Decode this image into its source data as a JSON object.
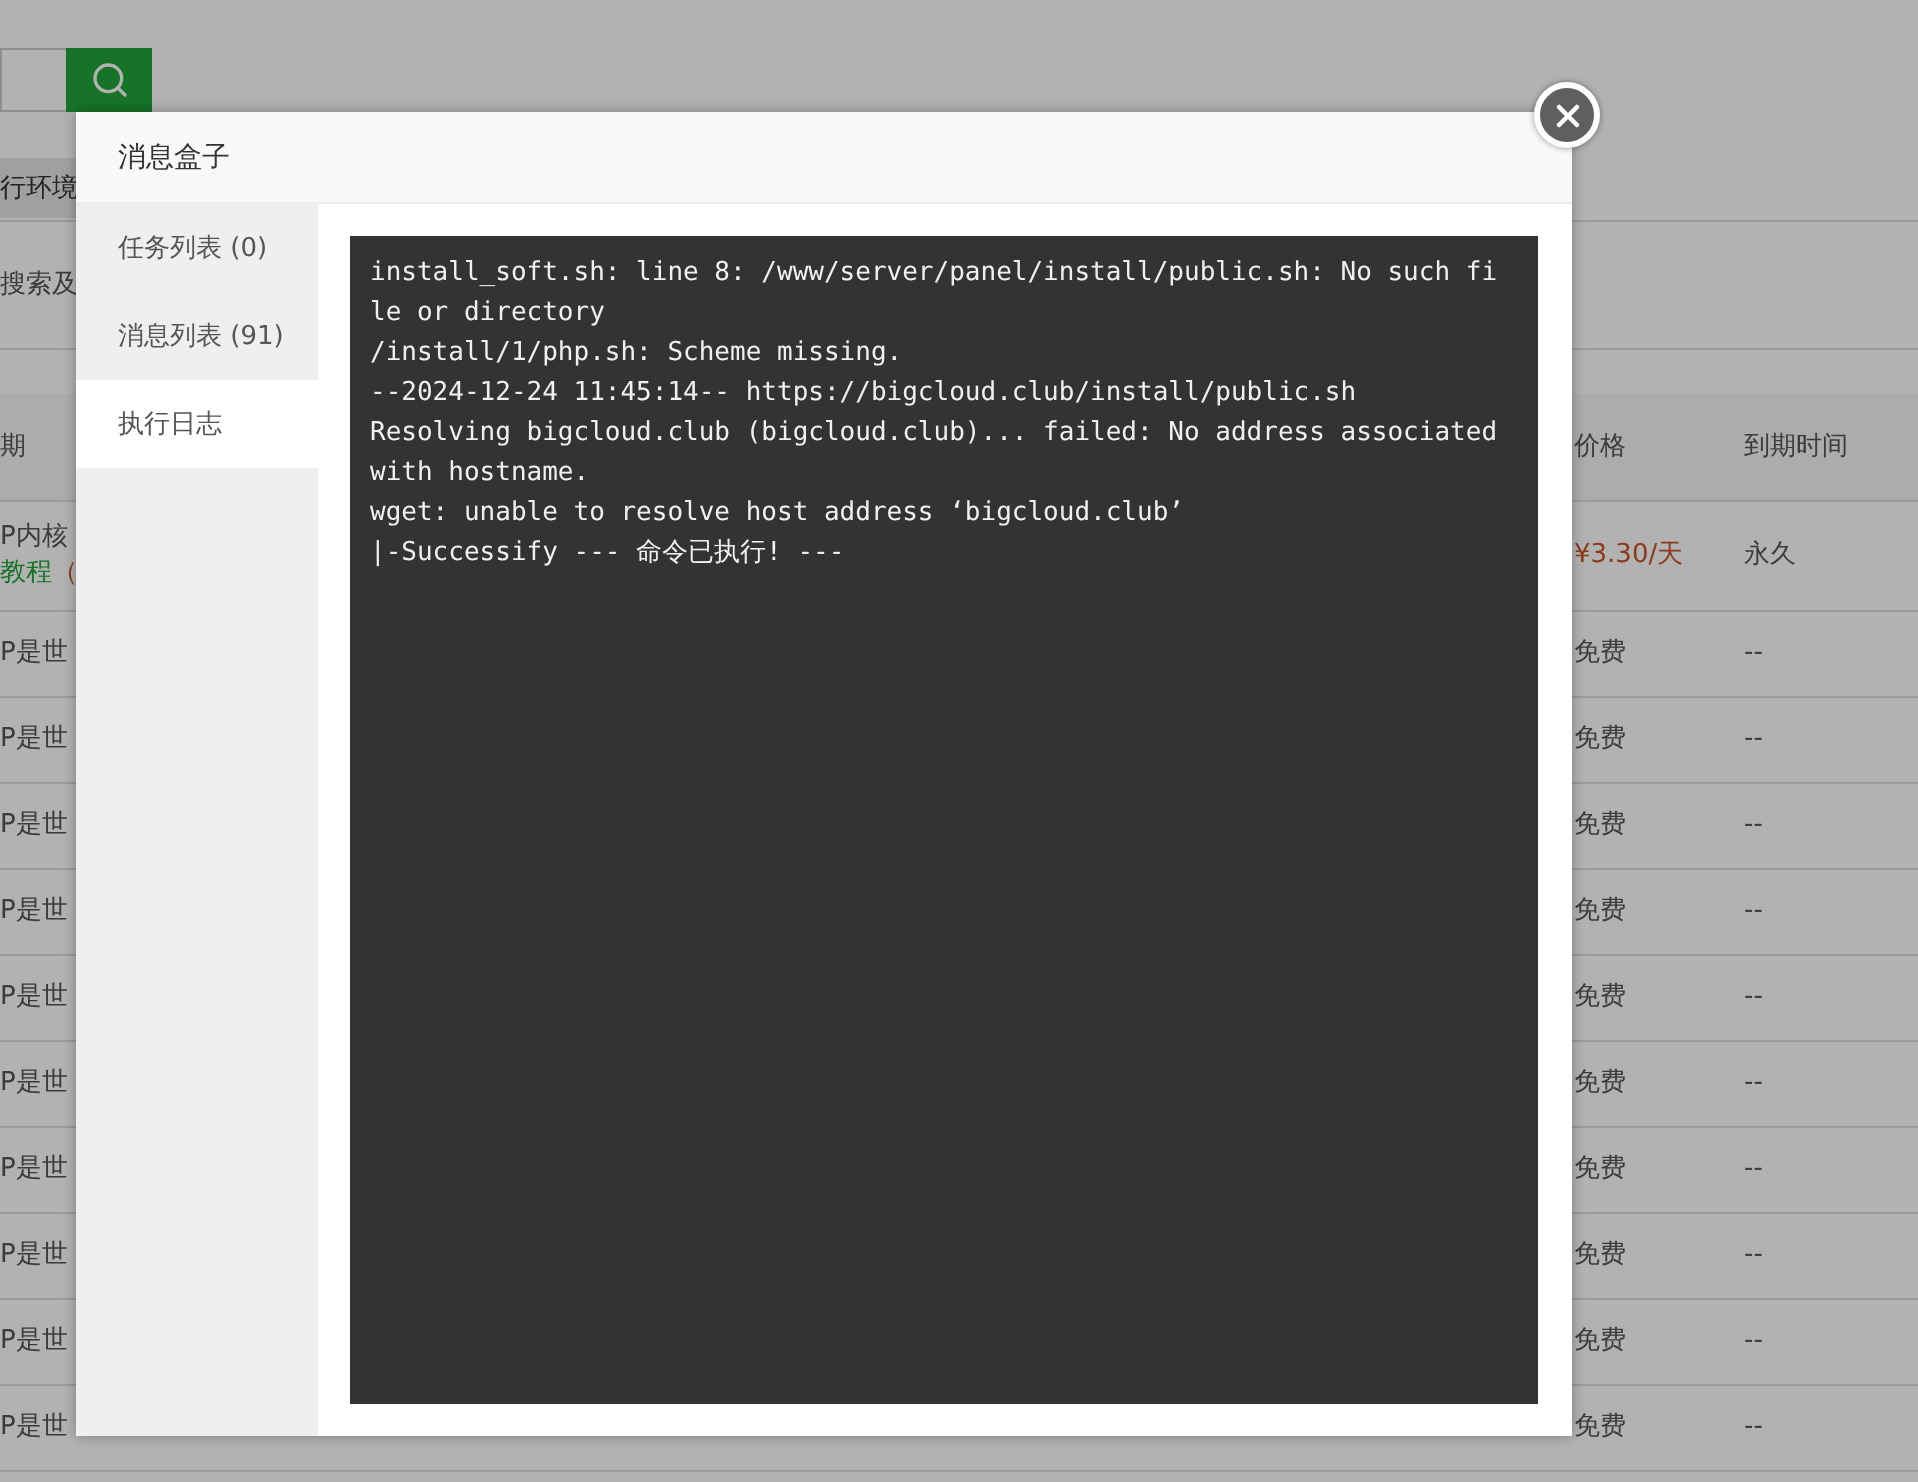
{
  "background_page": {
    "tabs": [
      {
        "label": "行环境",
        "selected": true
      }
    ],
    "filter_label": "搜索及",
    "table": {
      "columns": [
        "期",
        "价格",
        "到期时间"
      ],
      "rows": [
        {
          "name": "P内核",
          "tutorial": "教程",
          "note": "（",
          "kind": "paid",
          "price": "¥3.30/天",
          "expiry": "永久"
        },
        {
          "name": "P是世",
          "kind": "free",
          "price": "免费",
          "expiry": "--"
        },
        {
          "name": "P是世",
          "kind": "free",
          "price": "免费",
          "expiry": "--"
        },
        {
          "name": "P是世",
          "kind": "free",
          "price": "免费",
          "expiry": "--"
        },
        {
          "name": "P是世",
          "kind": "free",
          "price": "免费",
          "expiry": "--"
        },
        {
          "name": "P是世",
          "kind": "free",
          "price": "免费",
          "expiry": "--"
        },
        {
          "name": "P是世",
          "kind": "free",
          "price": "免费",
          "expiry": "--"
        },
        {
          "name": "P是世",
          "kind": "free",
          "price": "免费",
          "expiry": "--"
        },
        {
          "name": "P是世",
          "kind": "free",
          "price": "免费",
          "expiry": "--"
        },
        {
          "name": "P是世",
          "kind": "free",
          "price": "免费",
          "expiry": "--"
        },
        {
          "name": "P是世",
          "kind": "free",
          "price": "免费",
          "expiry": "--"
        }
      ]
    }
  },
  "dialog": {
    "title": "消息盒子",
    "tabs": [
      {
        "label": "任务列表 (0)",
        "selected": false
      },
      {
        "label": "消息列表 (91)",
        "selected": false
      },
      {
        "label": "执行日志",
        "selected": true
      }
    ],
    "log_lines": [
      "install_soft.sh: line 8: /www/server/panel/install/public.sh: No such file or directory",
      "/install/1/php.sh: Scheme missing.",
      "--2024-12-24 11:45:14-- https://bigcloud.club/install/public.sh",
      "Resolving bigcloud.club (bigcloud.club)... failed: No address associated with hostname.",
      "wget: unable to resolve host address ‘bigcloud.club’",
      "|-Successify --- 命令已执行! ---"
    ]
  }
}
